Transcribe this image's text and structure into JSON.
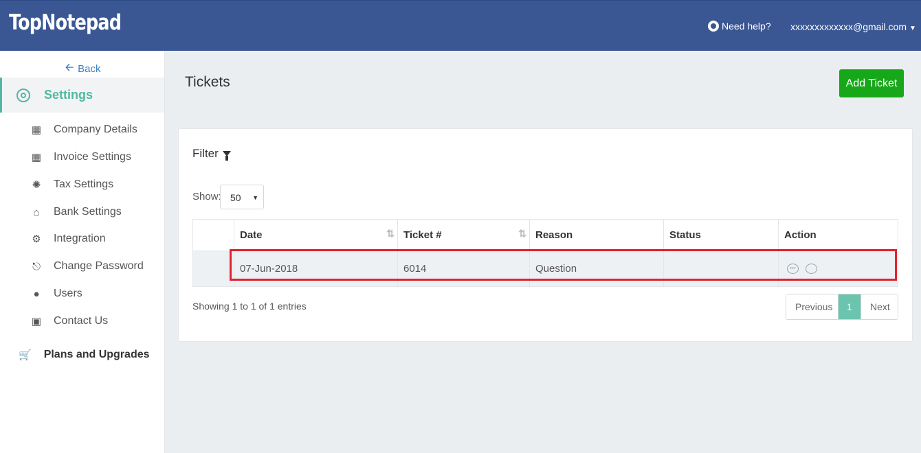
{
  "header": {
    "logo": "TopNotepad",
    "help_label": "Need help?",
    "user_email": "xxxxxxxxxxxxx@gmail.com"
  },
  "sidebar": {
    "back_label": "Back",
    "section_label": "Settings",
    "items": [
      {
        "label": "Company Details",
        "icon": "building-icon"
      },
      {
        "label": "Invoice Settings",
        "icon": "grid-icon"
      },
      {
        "label": "Tax Settings",
        "icon": "tax-badge-icon"
      },
      {
        "label": "Bank Settings",
        "icon": "bank-icon"
      },
      {
        "label": "Integration",
        "icon": "cogs-icon"
      },
      {
        "label": "Change Password",
        "icon": "lock-icon"
      },
      {
        "label": "Users",
        "icon": "users-icon"
      },
      {
        "label": "Contact Us",
        "icon": "contact-card-icon"
      }
    ],
    "plans_label": "Plans and Upgrades"
  },
  "main": {
    "title": "Tickets",
    "add_button": "Add Ticket",
    "filter_label": "Filter",
    "show_label": "Show:",
    "show_value": "50",
    "table": {
      "headers": [
        "",
        "Date",
        "Ticket #",
        "Reason",
        "Status",
        "Action"
      ],
      "rows": [
        {
          "date": "07-Jun-2018",
          "ticket": "6014",
          "reason": "Question",
          "status": ""
        }
      ]
    },
    "entries_text": "Showing 1 to 1 of 1 entries",
    "pager": {
      "previous": "Previous",
      "page": "1",
      "next": "Next"
    }
  },
  "colors": {
    "header_bg": "#3a5794",
    "accent": "#4fb99f",
    "add_button": "#17a81a",
    "highlight": "#e0222d"
  }
}
